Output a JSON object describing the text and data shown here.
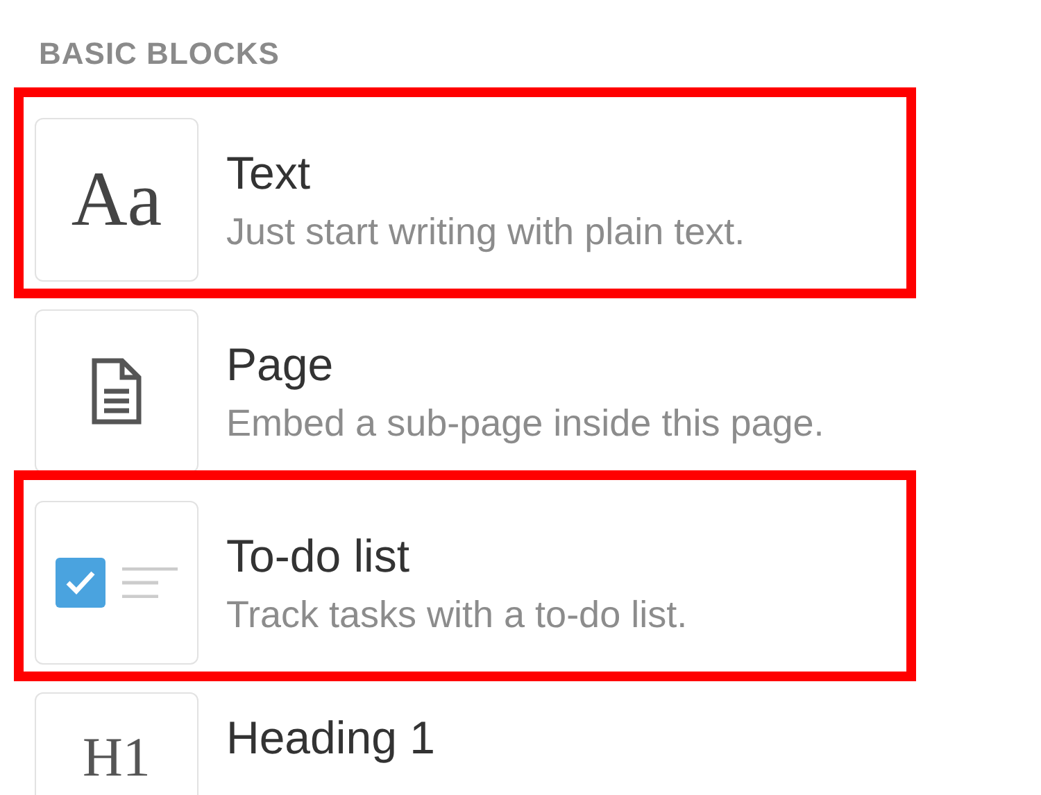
{
  "section": {
    "title": "BASIC BLOCKS"
  },
  "items": [
    {
      "kind": "text",
      "icon_label": "Aa",
      "title": "Text",
      "description": "Just start writing with plain text.",
      "highlighted": true
    },
    {
      "kind": "page",
      "title": "Page",
      "description": "Embed a sub-page inside this page.",
      "highlighted": false
    },
    {
      "kind": "todo",
      "title": "To-do list",
      "description": "Track tasks with a to-do list.",
      "highlighted": true,
      "checked": true
    },
    {
      "kind": "heading",
      "icon_label": "H1",
      "title": "Heading 1",
      "highlighted": false
    }
  ]
}
